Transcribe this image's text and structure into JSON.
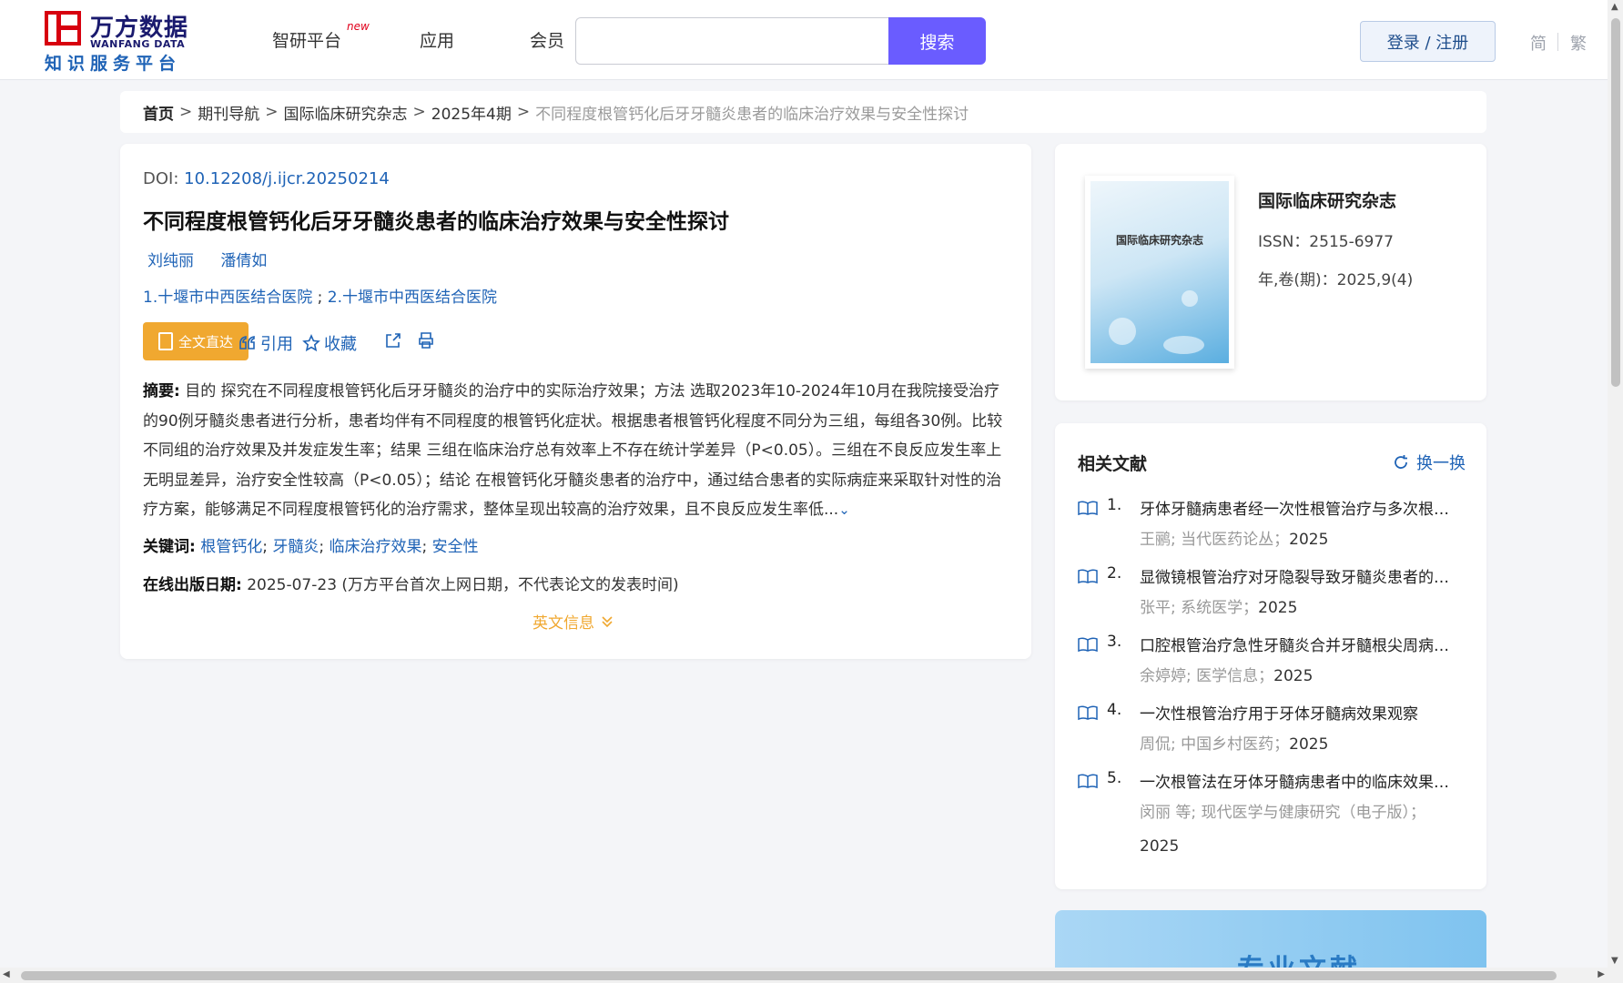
{
  "header": {
    "logo_cn": "万方数据",
    "logo_en": "WANFANG DATA",
    "logo_sub": "知识服务平台",
    "nav": [
      {
        "label": "智研平台",
        "badge": "new"
      },
      {
        "label": "应用"
      },
      {
        "label": "会员"
      }
    ],
    "search_value": "",
    "search_button": "搜索",
    "login_button": "登录 / 注册",
    "lang_simplified": "简",
    "lang_traditional": "繁"
  },
  "breadcrumb": {
    "home": "首页",
    "items": [
      "期刊导航",
      "国际临床研究杂志",
      "2025年4期"
    ],
    "current": "不同程度根管钙化后牙牙髓炎患者的临床治疗效果与安全性探讨",
    "separator": ">"
  },
  "article": {
    "doi_label": "DOI:",
    "doi_value": "10.12208/j.ijcr.20250214",
    "title": "不同程度根管钙化后牙牙髓炎患者的临床治疗效果与安全性探讨",
    "authors": [
      "刘纯丽",
      "潘倩如"
    ],
    "affiliations": [
      "1.十堰市中西医结合医院",
      "2.十堰市中西医结合医院"
    ],
    "affiliation_sep": ";",
    "fulltext_button": "全文直达",
    "cite_label": "引用",
    "collect_label": "收藏",
    "abstract_label": "摘要:",
    "abstract_text": "目的 探究在不同程度根管钙化后牙牙髓炎的治疗中的实际治疗效果；方法 选取2023年10-2024年10月在我院接受治疗的90例牙髓炎患者进行分析，患者均伴有不同程度的根管钙化症状。根据患者根管钙化程度不同分为三组，每组各30例。比较不同组的治疗效果及并发症发生率；结果 三组在临床治疗总有效率上不存在统计学差异（P<0.05）。三组在不良反应发生率上无明显差异，治疗安全性较高（P<0.05）；结论 在根管钙化牙髓炎患者的治疗中，通过结合患者的实际病症来采取针对性的治疗方案，能够满足不同程度根管钙化的治疗需求，整体呈现出较高的治疗效果，且不良反应发生率低...",
    "keywords_label": "关键词:",
    "keywords": [
      "根管钙化",
      "牙髓炎",
      "临床治疗效果",
      "安全性"
    ],
    "pubdate_label": "在线出版日期:",
    "pubdate_value": "2025-07-23",
    "pubdate_note": "(万方平台首次上网日期，不代表论文的发表时间)",
    "english_info": "英文信息"
  },
  "journal": {
    "cover_title": "国际临床研究杂志",
    "name": "国际临床研究杂志",
    "issn": "ISSN：2515-6977",
    "volume": "年,卷(期)：2025,9(4)"
  },
  "related": {
    "heading": "相关文献",
    "refresh": "换一换",
    "items": [
      {
        "num": "1.",
        "title": "牙体牙髓病患者经一次性根管治疗与多次根管治疗的临床效果",
        "meta": "王鹂; 当代医药论丛；",
        "year": "2025"
      },
      {
        "num": "2.",
        "title": "显微镜根管治疗对牙隐裂导致牙髓炎患者的影响",
        "meta": "张平; 系统医学；",
        "year": "2025"
      },
      {
        "num": "3.",
        "title": "口腔根管治疗急性牙髓炎合并牙髓根尖周病的效果",
        "meta": "余婷婷; 医学信息；",
        "year": "2025"
      },
      {
        "num": "4.",
        "title": "一次性根管治疗用于牙体牙髓病效果观察",
        "meta": "周侃; 中国乡村医药；",
        "year": "2025"
      },
      {
        "num": "5.",
        "title": "一次根管法在牙体牙髓病患者中的临床效果观察",
        "meta": "闵丽  等;  现代医学与健康研究（电子版）；",
        "year": "2025"
      }
    ]
  },
  "banner": {
    "text": "专业文献"
  },
  "colors": {
    "accent": "#6a5cff",
    "link": "#1f63b6",
    "orange": "#f0a830",
    "logo_red": "#d7000f"
  }
}
